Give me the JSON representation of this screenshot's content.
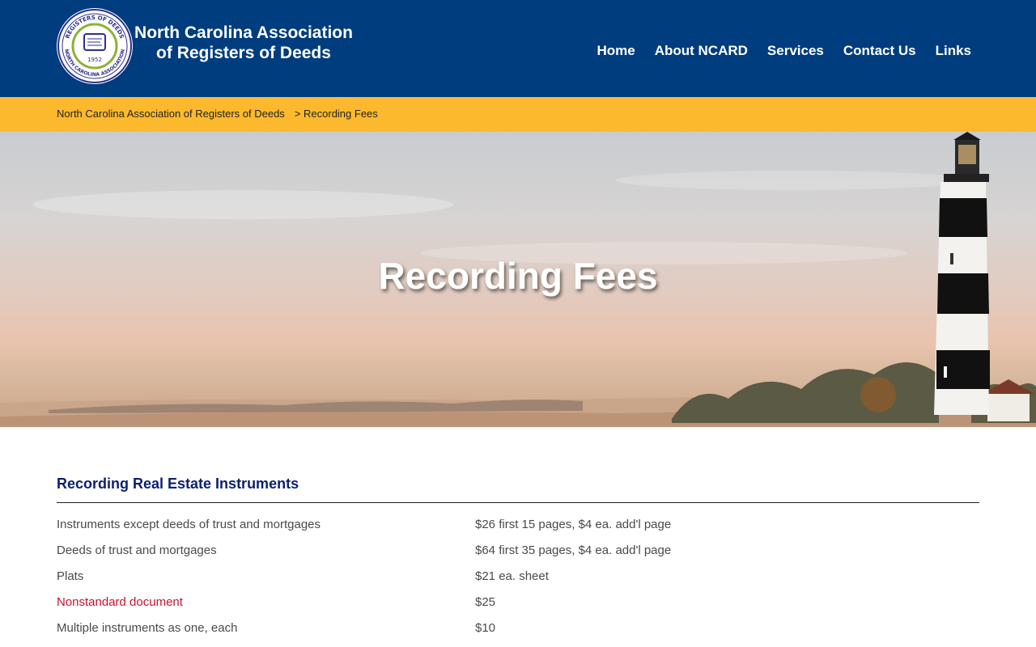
{
  "header": {
    "seal_text": {
      "top": "REGISTERS OF DEEDS",
      "bottom": "NORTH CAROLINA ASSOCIATION",
      "year": "1952"
    },
    "title_line1": "North Carolina Association",
    "title_line2": "of Registers of Deeds"
  },
  "nav": {
    "items": [
      {
        "label": "Home"
      },
      {
        "label": "About NCARD"
      },
      {
        "label": "Services"
      },
      {
        "label": "Contact Us"
      },
      {
        "label": "Links"
      }
    ]
  },
  "breadcrumb": {
    "home": "North Carolina Association of Registers of Deeds",
    "current": "> Recording Fees"
  },
  "hero": {
    "title": "Recording Fees"
  },
  "section": {
    "title": "Recording Real Estate Instruments",
    "rows": [
      {
        "label": "Instruments except deeds of trust and mortgages",
        "fee": "$26 first 15 pages, $4 ea. add'l page",
        "link": false
      },
      {
        "label": "Deeds of trust and mortgages",
        "fee": "$64 first 35 pages, $4 ea. add'l page",
        "link": false
      },
      {
        "label": "Plats",
        "fee": "$21 ea. sheet",
        "link": false
      },
      {
        "label": "Nonstandard document",
        "fee": "$25",
        "link": true
      },
      {
        "label": "Multiple instruments as one, each",
        "fee": "$10",
        "link": false
      }
    ]
  },
  "colors": {
    "header_bg": "#003d7e",
    "breadcrumb_bg": "#fdb92e",
    "section_title": "#0c1f6e",
    "link_red": "#c8102e"
  }
}
